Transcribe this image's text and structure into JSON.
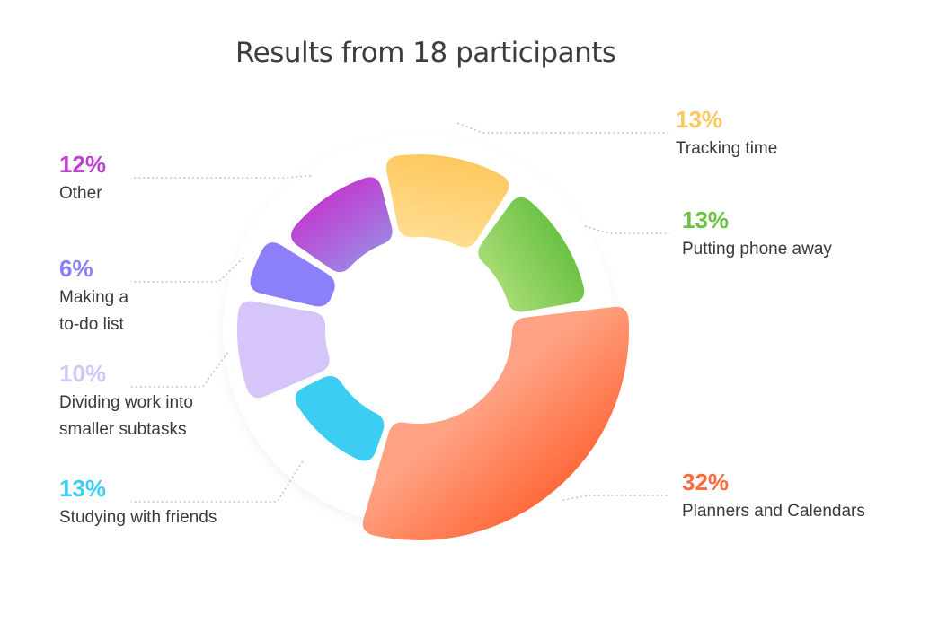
{
  "chart_data": {
    "type": "pie",
    "title": "Results from 18 participants",
    "slices": [
      {
        "label": "Tracking time",
        "value": 13,
        "value_label": "13%",
        "color": "#ffc85e",
        "color_light": "#ffdc8f"
      },
      {
        "label": "Putting phone away",
        "value": 13,
        "value_label": "13%",
        "color": "#6ac243",
        "color_light": "#a3db72"
      },
      {
        "label": "Planners and Calendars",
        "value": 32,
        "value_label": "32%",
        "color": "#ff6a3b",
        "color_light": "#ffa283"
      },
      {
        "label": "Studying with friends",
        "value": 13,
        "value_label": "13%",
        "color": "#3ccdf2",
        "color_light": "#3ccdf2"
      },
      {
        "label": "Dividing work into smaller subtasks",
        "value": 10,
        "value_label": "10%",
        "color": "#d6c5f8",
        "color_light": "#d6c5f8"
      },
      {
        "label": "Making a to-do list",
        "value": 6,
        "value_label": "6%",
        "color": "#8b80f9",
        "color_light": "#8b80f9"
      },
      {
        "label": "Other",
        "value": 12,
        "value_label": "12%",
        "color": "#c03ed0",
        "color_light": "#a07ee2"
      }
    ]
  }
}
